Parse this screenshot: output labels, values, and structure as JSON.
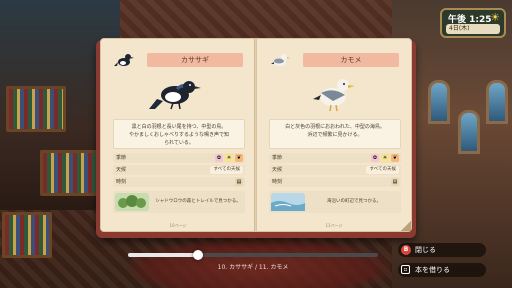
{
  "hud": {
    "time": "午後 1:25",
    "date": "4日(木)",
    "weather_icon": "sun-icon"
  },
  "left_page": {
    "name": "カササギ",
    "description_line1": "黒と白の羽根と長い尾を持つ、中型の鳥。",
    "description_line2": "やかましくおしゃべりするような鳴き声で知",
    "description_line3": "られている。",
    "season_label": "季節",
    "weather_label": "天候",
    "weather_value": "すべての天候",
    "time_label": "時刻",
    "habitat_text": "シャドウロウの森とトレイルで見つかる。",
    "page_number": "10ページ"
  },
  "right_page": {
    "name": "カモメ",
    "description_line1": "白と灰色の羽根におおわれた、中型の海鳥。",
    "description_line2": "浜辺で頻繁に見かける。",
    "season_label": "季節",
    "weather_label": "天候",
    "weather_value": "すべての天候",
    "time_label": "時刻",
    "habitat_text": "海沿いの町辺で見つかる。",
    "page_number": "11ページ"
  },
  "slider": {
    "label": "10. カササギ / 11. カモメ",
    "progress": 0.28
  },
  "buttons": {
    "close_key": "B",
    "close_label": "閉じる",
    "borrow_label": "本を借りる"
  },
  "colors": {
    "book_cover": "#8a3a30",
    "page": "#f3e6cd",
    "title_tab": "#f0b9a0",
    "close_key": "#d8463a"
  }
}
